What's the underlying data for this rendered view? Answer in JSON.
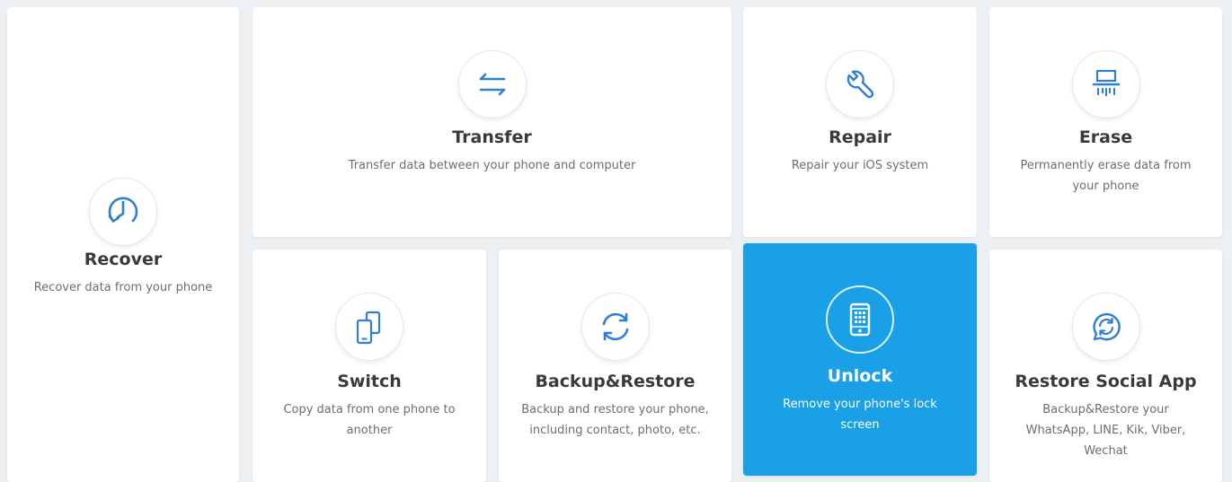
{
  "colors": {
    "accent": "#1aa0e6",
    "icon_blue": "#2f7fd3",
    "background": "#edf0f3",
    "card": "#ffffff"
  },
  "tools": {
    "recover": {
      "icon": "clock-restore-icon",
      "title": "Recover",
      "desc": "Recover data from your phone"
    },
    "transfer": {
      "icon": "transfer-arrows-icon",
      "title": "Transfer",
      "desc": "Transfer data between your phone and computer"
    },
    "repair": {
      "icon": "wrench-icon",
      "title": "Repair",
      "desc": "Repair your iOS system"
    },
    "erase": {
      "icon": "shredder-icon",
      "title": "Erase",
      "desc": "Permanently erase data from your phone"
    },
    "switch": {
      "icon": "phone-switch-icon",
      "title": "Switch",
      "desc": "Copy data from one phone to another"
    },
    "backup": {
      "icon": "sync-circle-icon",
      "title": "Backup&Restore",
      "desc": "Backup and restore your phone, including contact, photo, etc."
    },
    "unlock": {
      "icon": "phone-lock-icon",
      "title": "Unlock",
      "desc": "Remove your phone's lock screen",
      "selected": true
    },
    "social": {
      "icon": "chat-restore-icon",
      "title": "Restore Social App",
      "desc": "Backup&Restore your WhatsApp, LINE, Kik, Viber, Wechat"
    }
  }
}
